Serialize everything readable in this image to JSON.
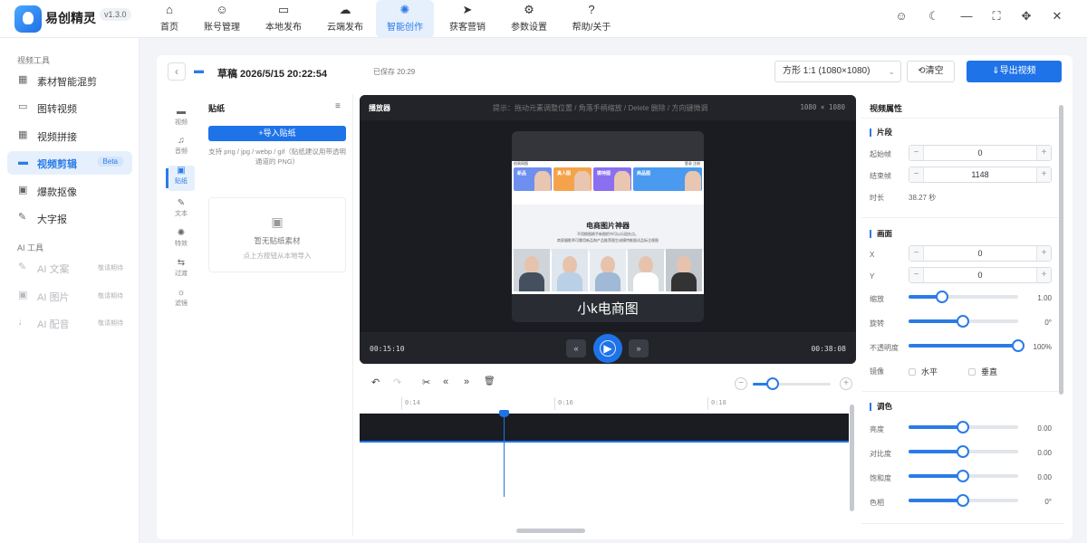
{
  "app": {
    "name": "易创精灵",
    "version": "v1.3.0"
  },
  "nav": [
    {
      "label": "首页",
      "icon": "home-icon",
      "glyph": "⌂"
    },
    {
      "label": "账号管理",
      "icon": "user-icon",
      "glyph": "☺"
    },
    {
      "label": "本地发布",
      "icon": "monitor-icon",
      "glyph": "▭"
    },
    {
      "label": "云端发布",
      "icon": "cloud-icon",
      "glyph": "☁"
    },
    {
      "label": "智能创作",
      "icon": "sparkle-icon",
      "glyph": "✺",
      "active": true
    },
    {
      "label": "获客营销",
      "icon": "send-icon",
      "glyph": "➤"
    },
    {
      "label": "参数设置",
      "icon": "gear-icon",
      "glyph": "⚙"
    },
    {
      "label": "帮助/关于",
      "icon": "help-icon",
      "glyph": "?"
    }
  ],
  "titlebar": [
    {
      "icon": "user-outline-icon",
      "glyph": "☺"
    },
    {
      "icon": "moon-icon",
      "glyph": "☾"
    },
    {
      "icon": "minimize-icon",
      "glyph": "—"
    },
    {
      "icon": "maximize-icon",
      "glyph": "⛶"
    },
    {
      "icon": "move-icon",
      "glyph": "✥"
    },
    {
      "icon": "close-icon",
      "glyph": "✕"
    }
  ],
  "sidebar": {
    "video_section": "视频工具",
    "video_items": [
      {
        "label": "素材智能混剪",
        "icon": "grid-icon",
        "glyph": "▦"
      },
      {
        "label": "图转视频",
        "icon": "video-icon",
        "glyph": "▭"
      },
      {
        "label": "视频拼接",
        "icon": "grid-icon",
        "glyph": "▦"
      },
      {
        "label": "视频剪辑",
        "icon": "car-icon",
        "glyph": "▬",
        "tag": "Beta",
        "active": true
      },
      {
        "label": "爆款抠像",
        "icon": "image-icon",
        "glyph": "▣"
      },
      {
        "label": "大字报",
        "icon": "pen-icon",
        "glyph": "✎"
      }
    ],
    "ai_section": "AI 工具",
    "ai_items": [
      {
        "label": "AI 文案",
        "icon": "pen-icon",
        "glyph": "✎",
        "tag": "敬请期待"
      },
      {
        "label": "AI 图片",
        "icon": "image-icon",
        "glyph": "▣",
        "tag": "敬请期待"
      },
      {
        "label": "AI 配音",
        "icon": "mic-icon",
        "glyph": "♩",
        "tag": "敬请期待"
      }
    ]
  },
  "header": {
    "back": "‹",
    "draft_title": "草稿 2026/5/15 20:22:54",
    "saved": "已保存 20:29",
    "ratio": "方形 1:1 (1080×1080)",
    "clear": "⟲清空",
    "export": "⇓导出视频"
  },
  "tools": [
    {
      "label": "视频",
      "icon": "car-icon",
      "glyph": "▬"
    },
    {
      "label": "音频",
      "icon": "headphone-icon",
      "glyph": "♫"
    },
    {
      "label": "贴纸",
      "icon": "image-icon",
      "glyph": "▣",
      "active": true
    },
    {
      "label": "文本",
      "icon": "pen-icon",
      "glyph": "✎"
    },
    {
      "label": "特效",
      "icon": "sparkle-icon",
      "glyph": "✺"
    },
    {
      "label": "过渡",
      "icon": "transition-icon",
      "glyph": "⇆"
    },
    {
      "label": "滤镜",
      "icon": "sun-icon",
      "glyph": "☼"
    }
  ],
  "sticker_panel": {
    "title": "贴纸",
    "menu": "≡",
    "import": "+导入贴纸",
    "hint": "支持 png / jpg / webp / gif（贴纸建议用带透明通道的 PNG）",
    "empty_icon": "▣",
    "empty_title": "暂无贴纸素材",
    "empty_sub": "点上方按钮从本地导入"
  },
  "player": {
    "title": "播放器",
    "hint": "提示：拖动元素调整位置 / 角落手柄缩放 / Delete 删除 / 方向键微调",
    "size": "1080 × 1080",
    "current": "00:15:10",
    "total": "00:38:08",
    "prev": "«",
    "next": "»",
    "play": "▶"
  },
  "frame": {
    "head_left": "创易网图",
    "head_right": "登录 注册",
    "cards": [
      {
        "t": "新品",
        "c": "#6d8ff0"
      },
      {
        "t": "真人图",
        "c": "#f5a34b"
      },
      {
        "t": "模特图",
        "c": "#8a6ff0"
      },
      {
        "t": "商品图",
        "c": "#4a9bf0"
      }
    ],
    "big": "电商图片神器",
    "sub1": "不用换图换手新图把书可以乐园先点。",
    "sub2": "商家摄影师可需用新品和产品推荐图生成模特推图试品标注视图",
    "caption": "小k电商图"
  },
  "timeline": {
    "undo": "↶",
    "redo": "↷",
    "cut": "✂",
    "back": "«",
    "fwd": "»",
    "del": "🗑",
    "zoom_minus": "−",
    "zoom_plus": "+",
    "ticks": [
      "0:14",
      "0:16",
      "0:18"
    ]
  },
  "props": {
    "title": "视频属性",
    "segment": "片段",
    "start_label": "起始帧",
    "start_val": "0",
    "end_label": "结束帧",
    "end_val": "1148",
    "dur_label": "时长",
    "dur_val": "38.27 秒",
    "canvas": "画面",
    "x_label": "X",
    "x_val": "0",
    "y_label": "Y",
    "y_val": "0",
    "scale_label": "缩放",
    "scale_val": "1.00",
    "rotate_label": "旋转",
    "rotate_val": "0°",
    "opacity_label": "不透明度",
    "opacity_val": "100%",
    "mirror_label": "镜像",
    "mirror_h": "水平",
    "mirror_v": "垂直",
    "color": "调色",
    "bright_label": "亮度",
    "bright_val": "0.00",
    "contrast_label": "对比度",
    "contrast_val": "0.00",
    "sat_label": "饱和度",
    "sat_val": "0.00",
    "hue_label": "色相",
    "hue_val": "0°",
    "minus": "−",
    "plus": "+"
  }
}
